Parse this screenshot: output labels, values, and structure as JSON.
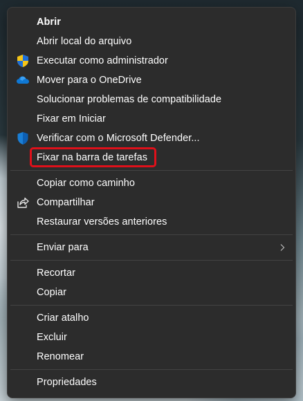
{
  "context_menu": {
    "items": [
      {
        "label": "Abrir",
        "icon": null
      },
      {
        "label": "Abrir local do arquivo",
        "icon": null
      },
      {
        "label": "Executar como administrador",
        "icon": "uac-shield-icon"
      },
      {
        "label": "Mover para o OneDrive",
        "icon": "onedrive-cloud-icon"
      },
      {
        "label": "Solucionar problemas de compatibilidade",
        "icon": null
      },
      {
        "label": "Fixar em Iniciar",
        "icon": null
      },
      {
        "label": "Verificar com o Microsoft Defender...",
        "icon": "defender-shield-icon"
      },
      {
        "label": "Fixar na barra de tarefas",
        "icon": null,
        "highlighted": true
      },
      {
        "label": "Copiar como caminho",
        "icon": null
      },
      {
        "label": "Compartilhar",
        "icon": "share-icon"
      },
      {
        "label": "Restaurar versões anteriores",
        "icon": null
      },
      {
        "label": "Enviar para",
        "icon": null,
        "submenu": true
      },
      {
        "label": "Recortar",
        "icon": null
      },
      {
        "label": "Copiar",
        "icon": null
      },
      {
        "label": "Criar atalho",
        "icon": null
      },
      {
        "label": "Excluir",
        "icon": null
      },
      {
        "label": "Renomear",
        "icon": null
      },
      {
        "label": "Propriedades",
        "icon": null
      }
    ]
  },
  "colors": {
    "menu_background": "#2c2c2c",
    "text": "#ffffff",
    "separator": "#434343",
    "highlight_border": "#e0101a",
    "onedrive_blue": "#0f78d4",
    "defender_blue": "#1a7fd6"
  }
}
